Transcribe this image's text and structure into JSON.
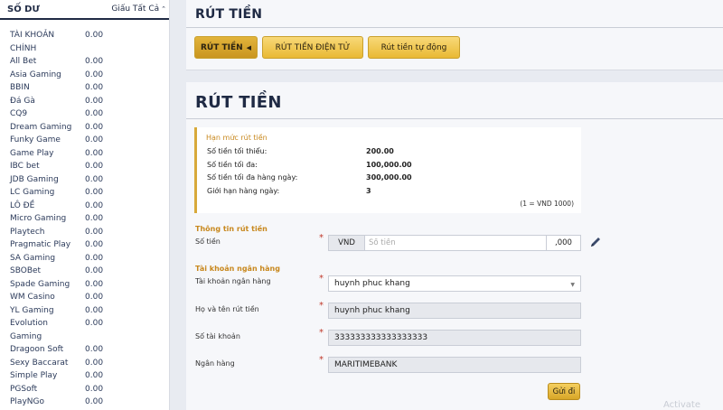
{
  "sidebar": {
    "title": "SỐ DƯ",
    "hide_all": "Giấu Tất Cả",
    "items": [
      {
        "name": "TÀI KHOẢN",
        "value": "0.00"
      },
      {
        "name": "CHÍNH",
        "value": ""
      },
      {
        "name": "All Bet",
        "value": "0.00"
      },
      {
        "name": "Asia Gaming",
        "value": "0.00"
      },
      {
        "name": "BBIN",
        "value": "0.00"
      },
      {
        "name": "Đá Gà",
        "value": "0.00"
      },
      {
        "name": "CQ9",
        "value": "0.00"
      },
      {
        "name": "Dream Gaming",
        "value": "0.00"
      },
      {
        "name": "Funky Game",
        "value": "0.00"
      },
      {
        "name": "Game Play",
        "value": "0.00"
      },
      {
        "name": "IBC bet",
        "value": "0.00"
      },
      {
        "name": "JDB Gaming",
        "value": "0.00"
      },
      {
        "name": "LC Gaming",
        "value": "0.00"
      },
      {
        "name": "LÔ ĐỀ",
        "value": "0.00"
      },
      {
        "name": "Micro Gaming",
        "value": "0.00"
      },
      {
        "name": "Playtech",
        "value": "0.00"
      },
      {
        "name": "Pragmatic Play",
        "value": "0.00"
      },
      {
        "name": "SA Gaming",
        "value": "0.00"
      },
      {
        "name": "SBOBet",
        "value": "0.00"
      },
      {
        "name": "Spade Gaming",
        "value": "0.00"
      },
      {
        "name": "WM Casino",
        "value": "0.00"
      },
      {
        "name": "YL Gaming",
        "value": "0.00"
      },
      {
        "name": "Evolution",
        "value": "0.00"
      },
      {
        "name": "Gaming",
        "value": ""
      },
      {
        "name": "Dragoon Soft",
        "value": "0.00"
      },
      {
        "name": "Sexy Baccarat",
        "value": "0.00"
      },
      {
        "name": "Simple Play",
        "value": "0.00"
      },
      {
        "name": "PGSoft",
        "value": "0.00"
      },
      {
        "name": "PlayNGo",
        "value": "0.00"
      }
    ]
  },
  "header": {
    "title": "RÚT TIỀN",
    "tabs": [
      {
        "label": "RÚT TIỀN"
      },
      {
        "label": "RÚT TIỀN ĐIỆN TỬ"
      },
      {
        "label": "Rút tiền tự động"
      }
    ]
  },
  "main": {
    "title": "RÚT TIỀN",
    "limits": {
      "title": "Hạn mức rút tiền",
      "rows": [
        {
          "label": "Số tiền tối thiểu:",
          "value": "200.00"
        },
        {
          "label": "Số tiền tối đa:",
          "value": "100,000.00"
        },
        {
          "label": "Số tiền tối đa hàng ngày:",
          "value": "300,000.00"
        },
        {
          "label": "Giới hạn hàng ngày:",
          "value": "3"
        }
      ],
      "note": "(1 = VND 1000)"
    },
    "withdraw_info": {
      "title": "Thông tin rút tiền",
      "amount_label": "Số tiền",
      "currency": "VND",
      "amount_placeholder": "Số tiền",
      "decimal_suffix": ",000"
    },
    "bank": {
      "title": "Tài khoản ngân hàng",
      "account_label": "Tài khoản ngân hàng",
      "account_value": "huynh phuc khang",
      "name_label": "Họ và tên rút tiền",
      "name_value": "huynh phuc khang",
      "number_label": "Số tài khoản",
      "number_value": "333333333333333333",
      "bankname_label": "Ngân hàng",
      "bankname_value": "MARITIMEBANK"
    },
    "required_mark": "*",
    "submit_label": "Gửi đi"
  },
  "watermark": "Activate"
}
